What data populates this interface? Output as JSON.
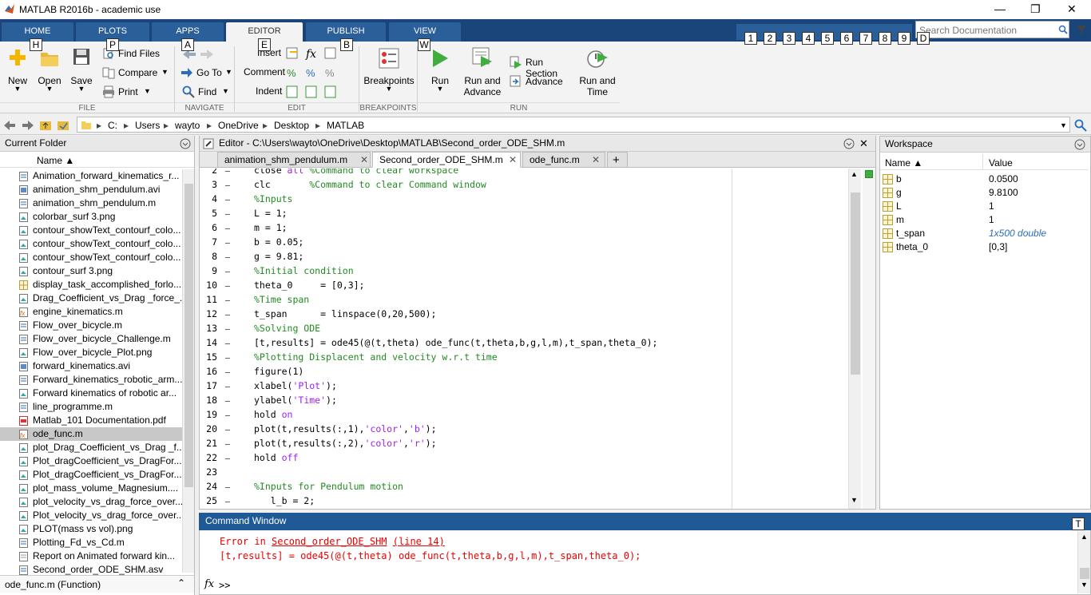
{
  "window": {
    "title": "MATLAB R2016b - academic use",
    "min": "—",
    "max": "❐",
    "close": "✕"
  },
  "tabs": [
    {
      "label": "HOME",
      "key": "H"
    },
    {
      "label": "PLOTS",
      "key": "P"
    },
    {
      "label": "APPS",
      "key": "A"
    },
    {
      "label": "EDITOR",
      "key": "E"
    },
    {
      "label": "PUBLISH",
      "key": "B"
    },
    {
      "label": "VIEW",
      "key": "W"
    }
  ],
  "quick_keys": [
    "1",
    "2",
    "3",
    "4",
    "5",
    "6",
    "7",
    "8",
    "9",
    "D"
  ],
  "search": {
    "placeholder": "Search Documentation"
  },
  "ribbon": {
    "new": "New",
    "open": "Open",
    "save": "Save",
    "find_files": "Find Files",
    "compare": "Compare",
    "print": "Print",
    "go_to": "Go To",
    "find": "Find",
    "insert": "Insert",
    "comment": "Comment",
    "indent": "Indent",
    "breakpoints": "Breakpoints",
    "run": "Run",
    "run_advance_1": "Run and",
    "run_advance_2": "Advance",
    "run_section": "Run Section",
    "advance": "Advance",
    "run_time_1": "Run and",
    "run_time_2": "Time",
    "groups": {
      "file": "FILE",
      "navigate": "NAVIGATE",
      "edit": "EDIT",
      "breakpoints": "BREAKPOINTS",
      "run": "RUN"
    }
  },
  "address": {
    "crumbs": [
      "C:",
      "Users",
      "wayto",
      "OneDrive",
      "Desktop",
      "MATLAB"
    ]
  },
  "current_folder": {
    "title": "Current Folder",
    "col_name": "Name ▲",
    "files": [
      "Animation_forward_kinematics_r...",
      "animation_shm_pendulum.avi",
      "animation_shm_pendulum.m",
      "colorbar_surf 3.png",
      "contour_showText_contourf_colo...",
      "contour_showText_contourf_colo...",
      "contour_showText_contourf_colo...",
      "contour_surf 3.png",
      "display_task_accomplished_forlo...",
      "Drag_Coefficient_vs_Drag _force_...",
      "engine_kinematics.m",
      "Flow_over_bicycle.m",
      "Flow_over_bicycle_Challenge.m",
      "Flow_over_bicycle_Plot.png",
      "forward_kinematics.avi",
      "Forward_kinematics_robotic_arm...",
      "Forward kinematics of robotic ar...",
      "line_programme.m",
      "Matlab_101 Documentation.pdf",
      "ode_func.m",
      "plot_Drag_Coefficient_vs_Drag _f...",
      "Plot_dragCoefficient_vs_DragFor...",
      "Plot_dragCoefficient_vs_DragFor...",
      "plot_mass_volume_Magnesium....",
      "plot_velocity_vs_drag_force_over...",
      "Plot_velocity_vs_drag_force_over...",
      "PLOT(mass vs vol).png",
      "Plotting_Fd_vs_Cd.m",
      "Report on  Animated forward kin...",
      "Second_order_ODE_SHM.asv"
    ],
    "footer": "ode_func.m  (Function)"
  },
  "editor": {
    "title": "Editor - C:\\Users\\wayto\\OneDrive\\Desktop\\MATLAB\\Second_order_ODE_SHM.m",
    "tabs": [
      "animation_shm_pendulum.m",
      "Second_order_ODE_SHM.m",
      "ode_func.m"
    ],
    "add_tab": "+",
    "lines": [
      {
        "n": "2",
        "code": "close all %Command to clear workspace"
      },
      {
        "n": "3",
        "code": "clc       %Command to clear Command window"
      },
      {
        "n": "4",
        "code": "%Inputs"
      },
      {
        "n": "5",
        "code": "L = 1;"
      },
      {
        "n": "6",
        "code": "m = 1;"
      },
      {
        "n": "7",
        "code": "b = 0.05;"
      },
      {
        "n": "8",
        "code": "g = 9.81;"
      },
      {
        "n": "9",
        "code": "%Initial condition"
      },
      {
        "n": "10",
        "code": "theta_0     = [0,3];"
      },
      {
        "n": "11",
        "code": "%Time span"
      },
      {
        "n": "12",
        "code": "t_span      = linspace(0,20,500);"
      },
      {
        "n": "13",
        "code": "%Solving ODE"
      },
      {
        "n": "14",
        "code": "[t,results] = ode45(@(t,theta) ode_func(t,theta,b,g,l,m),t_span,theta_0);"
      },
      {
        "n": "15",
        "code": "%Plotting Displacent and velocity w.r.t time"
      },
      {
        "n": "16",
        "code": "figure(1)"
      },
      {
        "n": "17",
        "code": "xlabel('Plot');"
      },
      {
        "n": "18",
        "code": "ylabel('Time');"
      },
      {
        "n": "19",
        "code": "hold on"
      },
      {
        "n": "20",
        "code": "plot(t,results(:,1),'color','b');"
      },
      {
        "n": "21",
        "code": "plot(t,results(:,2),'color','r');"
      },
      {
        "n": "22",
        "code": "hold off"
      },
      {
        "n": "23",
        "code": ""
      },
      {
        "n": "24",
        "code": "%Inputs for Pendulum motion"
      },
      {
        "n": "25",
        "code": "   l_b = 2;"
      }
    ]
  },
  "workspace": {
    "title": "Workspace",
    "col_name": "Name ▲",
    "col_value": "Value",
    "vars": [
      {
        "name": "b",
        "value": "0.0500"
      },
      {
        "name": "g",
        "value": "9.8100"
      },
      {
        "name": "L",
        "value": "1"
      },
      {
        "name": "m",
        "value": "1"
      },
      {
        "name": "t_span",
        "value": "1x500 double"
      },
      {
        "name": "theta_0",
        "value": "[0,3]"
      }
    ]
  },
  "command_window": {
    "title": "Command Window",
    "key": "T",
    "error_prefix": "Error in ",
    "error_file": "Second_order_ODE_SHM",
    "error_line": "(line 14)",
    "error_code": "[t,results] = ode45(@(t,theta) ode_func(t,theta,b,g,l,m),t_span,theta_0);",
    "prompt": ">>",
    "fx": "fx"
  }
}
